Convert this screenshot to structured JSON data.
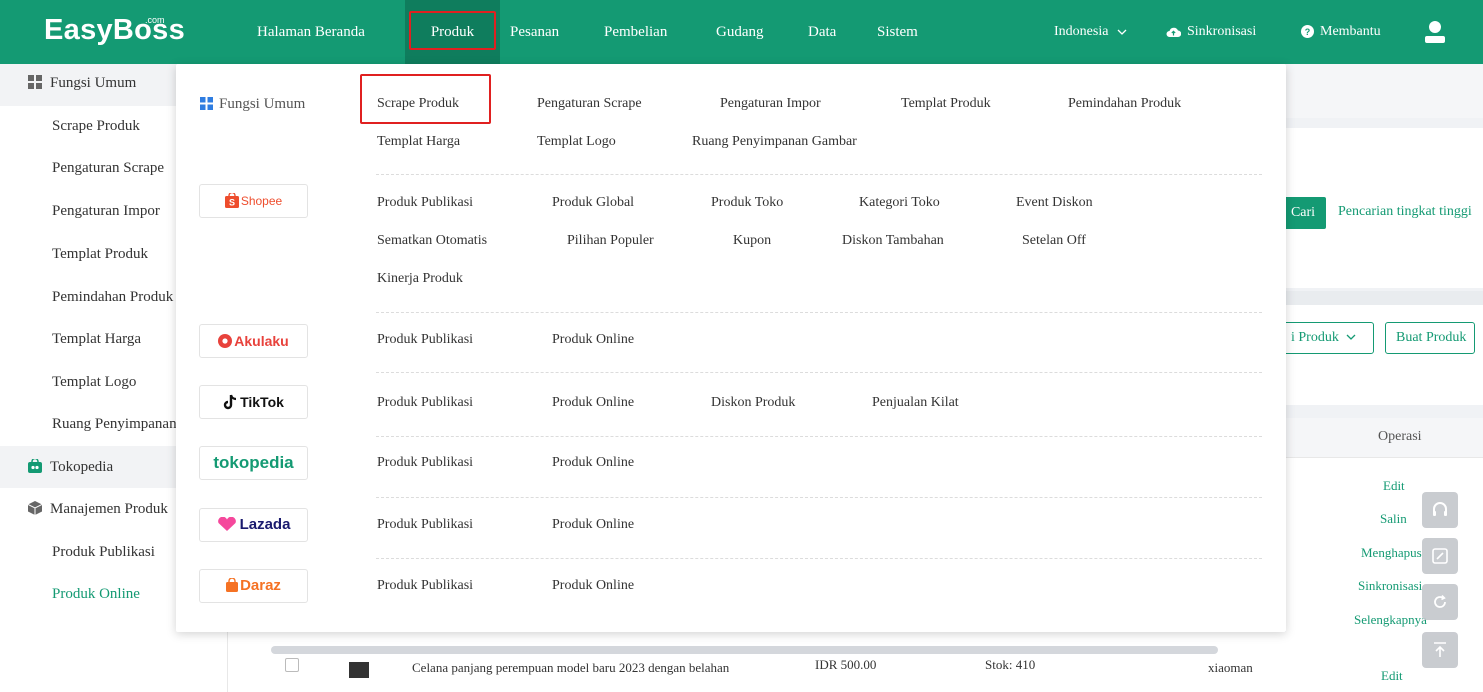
{
  "brand": {
    "logo": "EasyBoss",
    "logo_suffix": ".com",
    "accent": "#149a73"
  },
  "topnav": {
    "items": [
      "Halaman Beranda",
      "Produk",
      "Pesanan",
      "Pembelian",
      "Gudang",
      "Data",
      "Sistem"
    ],
    "active": "Produk",
    "region": "Indonesia",
    "sync": "Sinkronisasi",
    "help": "Membantu"
  },
  "sidebar": {
    "group1": "Fungsi Umum",
    "group1_items": [
      "Scrape Produk",
      "Pengaturan Scrape",
      "Pengaturan Impor",
      "Templat Produk",
      "Pemindahan Produk",
      "Templat Harga",
      "Templat Logo",
      "Ruang Penyimpanan"
    ],
    "group2": "Tokopedia",
    "group3": "Manajemen Produk",
    "group3_items": [
      "Produk Publikasi",
      "Produk Online"
    ],
    "active_item": "Produk Online"
  },
  "background": {
    "cari": "Cari",
    "advanced_search": "Pencarian tingkat tinggi",
    "produk_dropdown": "i Produk",
    "buat_produk": "Buat Produk",
    "operasi_header": "Operasi",
    "actions": [
      "Edit",
      "Salin",
      "Menghapus",
      "Sinkronisasi",
      "Selengkapnya"
    ],
    "row": {
      "title": "Celana panjang perempuan model baru 2023 dengan belahan",
      "price": "IDR 500.00",
      "stock": "Stok:  410",
      "store": "xiaoman",
      "edit": "Edit"
    }
  },
  "mega_menu": {
    "general": {
      "title": "Fungsi Umum",
      "row1": [
        "Scrape Produk",
        "Pengaturan Scrape",
        "Pengaturan Impor",
        "Templat Produk",
        "Pemindahan Produk"
      ],
      "row2": [
        "Templat Harga",
        "Templat Logo",
        "Ruang Penyimpanan Gambar"
      ]
    },
    "platforms": [
      {
        "name": "Shopee",
        "row1": [
          "Produk Publikasi",
          "Produk Global",
          "Produk Toko",
          "Kategori Toko",
          "Event Diskon"
        ],
        "row2": [
          "Sematkan Otomatis",
          "Pilihan Populer",
          "Kupon",
          "Diskon Tambahan",
          "Setelan Off"
        ],
        "row3": [
          "Kinerja Produk"
        ]
      },
      {
        "name": "Akulaku",
        "row1": [
          "Produk Publikasi",
          "Produk Online"
        ]
      },
      {
        "name": "TikTok",
        "row1": [
          "Produk Publikasi",
          "Produk Online",
          "Diskon Produk",
          "Penjualan Kilat"
        ]
      },
      {
        "name": "tokopedia",
        "row1": [
          "Produk Publikasi",
          "Produk Online"
        ]
      },
      {
        "name": "Lazada",
        "row1": [
          "Produk Publikasi",
          "Produk Online"
        ]
      },
      {
        "name": "Daraz",
        "row1": [
          "Produk Publikasi",
          "Produk Online"
        ]
      }
    ]
  }
}
